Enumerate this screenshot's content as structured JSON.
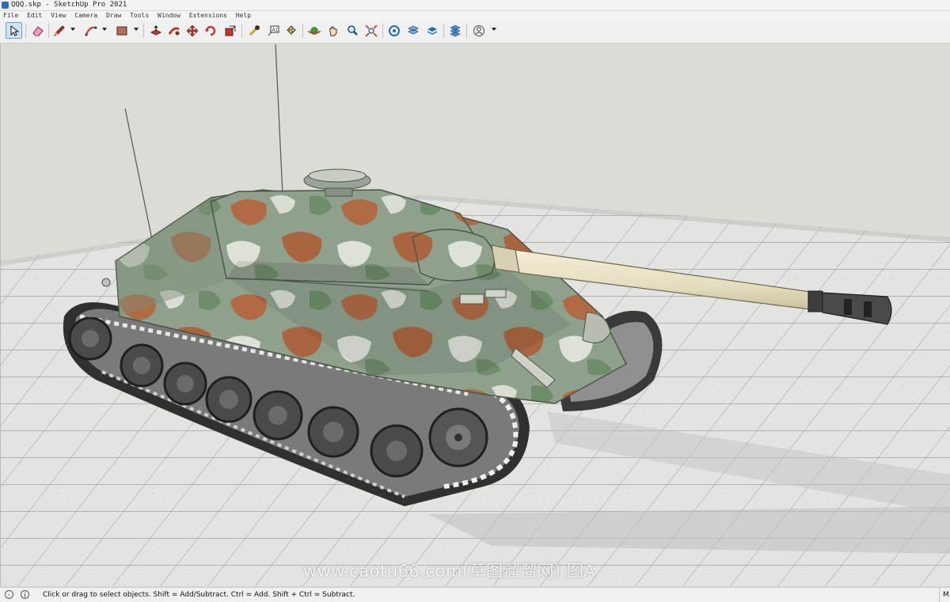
{
  "window": {
    "title": "QQQ.skp - SketchUp Pro 2021"
  },
  "menu": [
    "File",
    "Edit",
    "View",
    "Camera",
    "Draw",
    "Tools",
    "Window",
    "Extensions",
    "Help"
  ],
  "toolbar": {
    "select": "select-icon",
    "eraser": "eraser-icon",
    "pencil": "pencil-icon",
    "arc": "arc-icon",
    "rectangle": "rectangle-icon",
    "push_pull": "push-pull-icon",
    "follow_me": "follow-me-icon",
    "move": "move-icon",
    "rotate": "rotate-icon",
    "scale": "scale-icon",
    "tape": "tape-measure-icon",
    "text": "text-icon",
    "paint": "paint-bucket-icon",
    "orbit": "orbit-icon",
    "pan": "pan-icon",
    "zoom": "zoom-icon",
    "zoom_extents": "zoom-extents-icon",
    "warehouse": "3d-warehouse-icon",
    "extension_warehouse": "extension-warehouse-icon",
    "layout": "send-to-layout-icon",
    "extension_manager": "extension-manager-icon",
    "account": "account-icon"
  },
  "viewport": {
    "model": "tank",
    "background": "#dbdbd6",
    "ground": "#e2e2e0"
  },
  "watermark": {
    "text": "www.caotu66.com(草图溜溜网) 图A"
  },
  "status": {
    "message": "Click or drag to select objects. Shift = Add/Subtract. Ctrl = Add. Shift + Ctrl = Subtract.",
    "measurements_label": "M"
  },
  "colors": {
    "accent": "#6d9fd3",
    "camo_base": "#8f9d8c",
    "camo_brown": "#a9653f",
    "gun_barrel": "#e6e0c3"
  }
}
